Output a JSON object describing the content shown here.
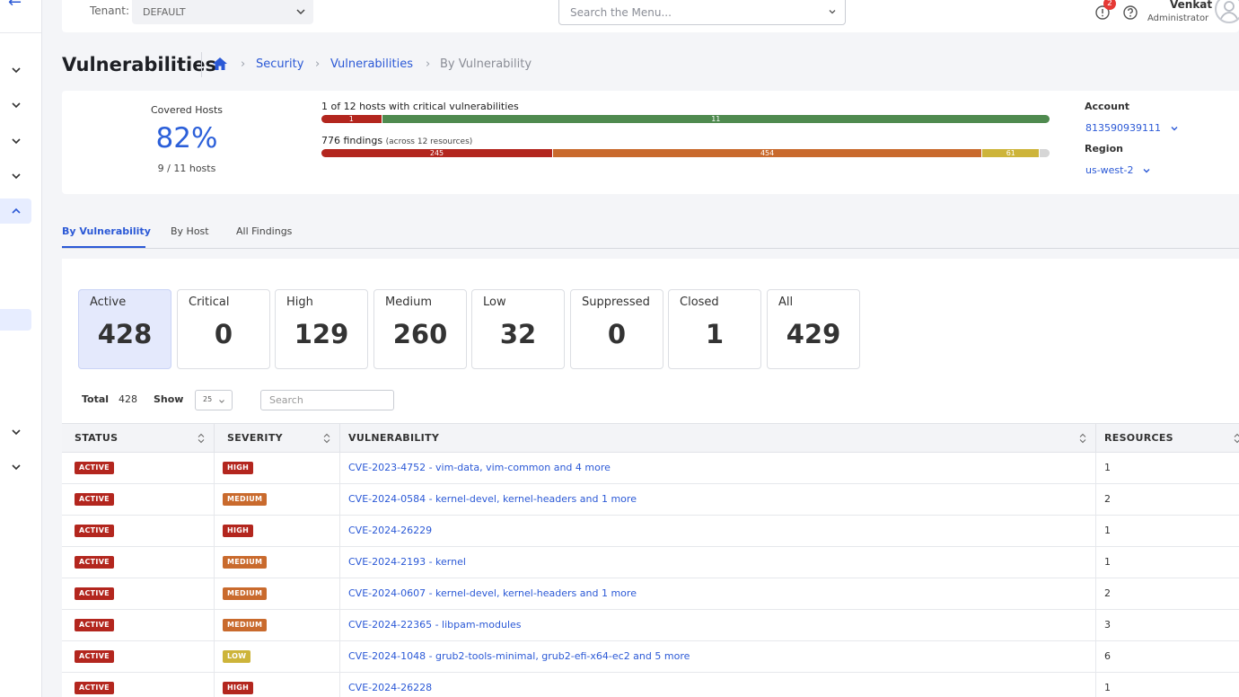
{
  "sidebar": {
    "back_icon": "arrow-left-icon",
    "collapse_icon": "chevron-down-icon",
    "expand_icon": "chevron-up-icon"
  },
  "topbar": {
    "tenant_label": "Tenant:",
    "tenant_value": "DEFAULT",
    "menu_search_placeholder": "Search the Menu...",
    "alert_count": "2",
    "user_name": "Venkat",
    "user_role": "Administrator"
  },
  "header": {
    "title": "Vulnerabilities",
    "breadcrumb": [
      "Security",
      "Vulnerabilities",
      "By Vulnerability"
    ]
  },
  "summary": {
    "covered_label": "Covered Hosts",
    "covered_value": "82%",
    "covered_sub": "9 / 11 hosts",
    "hosts_bar_title": "1 of 12 hosts with critical vulnerabilities",
    "hosts_bar": [
      {
        "label": "1",
        "value": 1,
        "color": "#b3261e"
      },
      {
        "label": "11",
        "value": 11,
        "color": "#4f8a4f"
      }
    ],
    "findings_title": "776 findings",
    "findings_sub": "(across 12 resources)",
    "findings_bar": [
      {
        "label": "245",
        "value": 245,
        "color": "#b3261e"
      },
      {
        "label": "454",
        "value": 454,
        "color": "#c96a2d"
      },
      {
        "label": "61",
        "value": 61,
        "color": "#cdb43a"
      },
      {
        "label": "",
        "value": 10,
        "color": "#d6d6d6"
      }
    ],
    "account_label": "Account",
    "account_value": "813590939111",
    "region_label": "Region",
    "region_value": "us-west-2"
  },
  "tabs": [
    "By Vulnerability",
    "By Host",
    "All Findings"
  ],
  "stats": [
    {
      "label": "Active",
      "value": "428"
    },
    {
      "label": "Critical",
      "value": "0"
    },
    {
      "label": "High",
      "value": "129"
    },
    {
      "label": "Medium",
      "value": "260"
    },
    {
      "label": "Low",
      "value": "32"
    },
    {
      "label": "Suppressed",
      "value": "0"
    },
    {
      "label": "Closed",
      "value": "1"
    },
    {
      "label": "All",
      "value": "429"
    }
  ],
  "controls": {
    "total_label": "Total",
    "total_value": "428",
    "show_label": "Show",
    "show_value": "25",
    "search_placeholder": "Search"
  },
  "table": {
    "columns": [
      "STATUS",
      "SEVERITY",
      "VULNERABILITY",
      "RESOURCES"
    ],
    "severity_colors": {
      "HIGH": "#b3261e",
      "MEDIUM": "#c96a2d",
      "LOW": "#cdb43a"
    },
    "status_color": "#b3261e",
    "rows": [
      {
        "status": "ACTIVE",
        "severity": "HIGH",
        "vulnerability": "CVE-2023-4752 - vim-data, vim-common and 4 more",
        "resources": "1"
      },
      {
        "status": "ACTIVE",
        "severity": "MEDIUM",
        "vulnerability": "CVE-2024-0584 - kernel-devel, kernel-headers and 1 more",
        "resources": "2"
      },
      {
        "status": "ACTIVE",
        "severity": "HIGH",
        "vulnerability": "CVE-2024-26229",
        "resources": "1"
      },
      {
        "status": "ACTIVE",
        "severity": "MEDIUM",
        "vulnerability": "CVE-2024-2193 - kernel",
        "resources": "1"
      },
      {
        "status": "ACTIVE",
        "severity": "MEDIUM",
        "vulnerability": "CVE-2024-0607 - kernel-devel, kernel-headers and 1 more",
        "resources": "2"
      },
      {
        "status": "ACTIVE",
        "severity": "MEDIUM",
        "vulnerability": "CVE-2024-22365 - libpam-modules",
        "resources": "3"
      },
      {
        "status": "ACTIVE",
        "severity": "LOW",
        "vulnerability": "CVE-2024-1048 - grub2-tools-minimal, grub2-efi-x64-ec2 and 5 more",
        "resources": "6"
      },
      {
        "status": "ACTIVE",
        "severity": "HIGH",
        "vulnerability": "CVE-2024-26228",
        "resources": "1"
      }
    ]
  }
}
